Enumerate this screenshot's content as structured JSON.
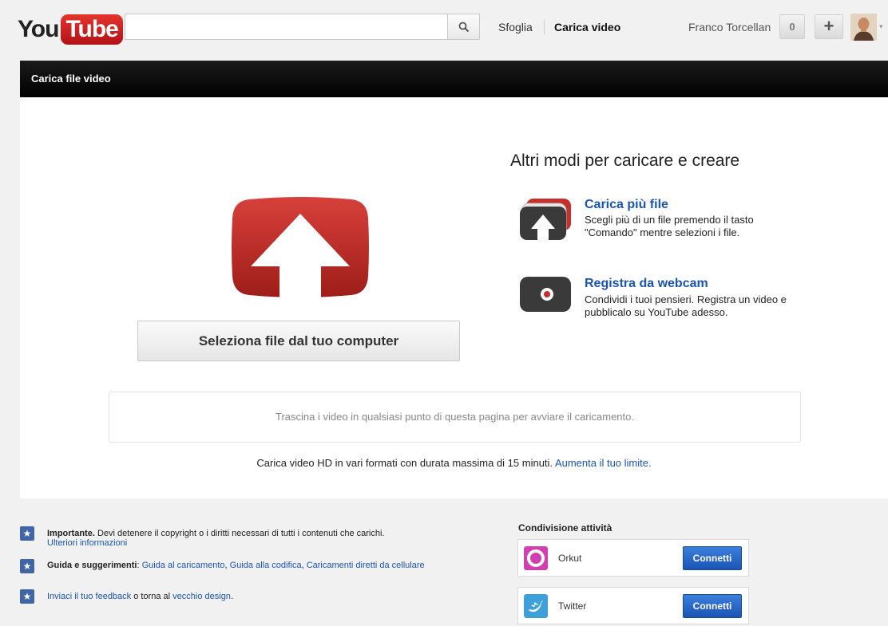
{
  "header": {
    "logo_you": "You",
    "logo_tube": "Tube",
    "search_placeholder": "",
    "nav_browse": "Sfoglia",
    "nav_upload": "Carica video",
    "user_name": "Franco Torcellan",
    "notification_count": "0",
    "create_label": "+"
  },
  "page": {
    "title": "Carica file video"
  },
  "upload": {
    "select_button": "Seleziona file dal tuo computer",
    "others_title": "Altri modi per caricare e creare",
    "option_multi_title": "Carica più file",
    "option_multi_desc": "Scegli più di un file premendo il tasto \"Comando\" mentre selezioni i file.",
    "option_webcam_title": "Registra da webcam",
    "option_webcam_desc": "Condividi i tuoi pensieri. Registra un video e pubblicalo su YouTube adesso.",
    "dropzone_text": "Trascina i video in qualsiasi punto di questa pagina per avviare il caricamento.",
    "hd_note": "Carica video HD in vari formati con durata massima di 15 minuti.",
    "hd_link": "Aumenta il tuo limite."
  },
  "footer": {
    "important_bold": "Importante.",
    "important_text": " Devi detenere il copyright o i diritti necessari di tutti i contenuti che carichi.",
    "important_link": "Ulteriori informazioni",
    "guide_bold": "Guida e suggerimenti",
    "guide_colon": ": ",
    "guide_link1": "Guida al caricamento",
    "guide_link2": "Guida alla codifica",
    "guide_link3": "Caricamenti diretti da cellulare",
    "sep": ", ",
    "feedback_link": "Inviaci il tuo feedback",
    "feedback_mid": " o torna al ",
    "feedback_link2": "vecchio design",
    "feedback_end": "."
  },
  "sharing": {
    "title": "Condivisione attività",
    "services": [
      {
        "name": "Orkut",
        "button": "Connetti"
      },
      {
        "name": "Twitter",
        "button": "Connetti"
      }
    ]
  },
  "colors": {
    "brand_red": "#c4302b",
    "link_blue": "#1a55b5",
    "connect_blue": "#2a6bd0"
  }
}
